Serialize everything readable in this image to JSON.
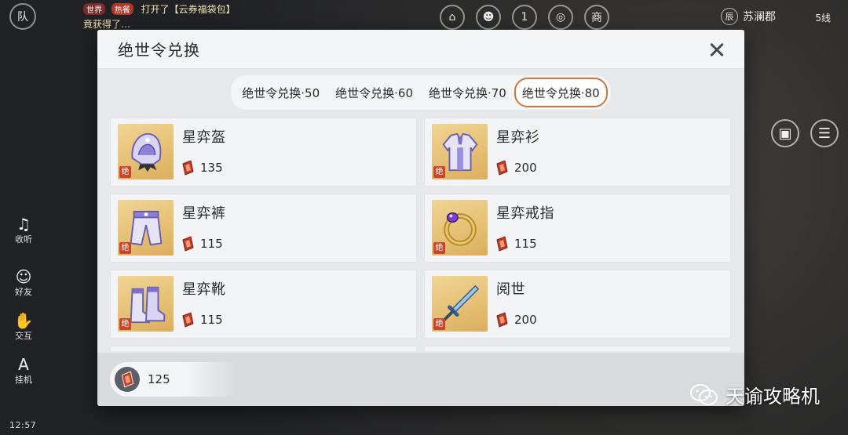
{
  "hud": {
    "team_label": "队",
    "chat_channel": "世界",
    "chat_tag": "热餐",
    "chat_line1": "打开了【云券福袋包】",
    "chat_line2": "竟获得了…",
    "location": "苏澜郡",
    "location_icon_text": "辰",
    "server_line": "5线",
    "shop_label": "商",
    "calendar_day": "1",
    "time": "12:57"
  },
  "sidebar": {
    "listen_label": "收听",
    "friends_label": "好友",
    "interact_label": "交互",
    "afk_label": "挂机"
  },
  "modal": {
    "title": "绝世令兑换",
    "tabs": [
      {
        "label": "绝世令兑换·50",
        "active": false
      },
      {
        "label": "绝世令兑换·60",
        "active": false
      },
      {
        "label": "绝世令兑换·70",
        "active": false
      },
      {
        "label": "绝世令兑换·80",
        "active": true
      }
    ],
    "items": [
      {
        "name": "星弈盔",
        "price": "135",
        "grade": "绝",
        "icon": "helmet-icon"
      },
      {
        "name": "星弈衫",
        "price": "200",
        "grade": "绝",
        "icon": "robe-icon"
      },
      {
        "name": "星弈裤",
        "price": "115",
        "grade": "绝",
        "icon": "pants-icon"
      },
      {
        "name": "星弈戒指",
        "price": "115",
        "grade": "绝",
        "icon": "ring-icon"
      },
      {
        "name": "星弈靴",
        "price": "115",
        "grade": "绝",
        "icon": "boots-icon"
      },
      {
        "name": "阅世",
        "price": "200",
        "grade": "绝",
        "icon": "sword-icon"
      }
    ],
    "balance": "125"
  },
  "watermark": {
    "text": "天谕攻略机"
  },
  "colors": {
    "accent_tab_border": "#c9773f",
    "thumb_gold": "#dcae5c",
    "grade_red": "#c7462c",
    "token_red": "#c0392b"
  }
}
